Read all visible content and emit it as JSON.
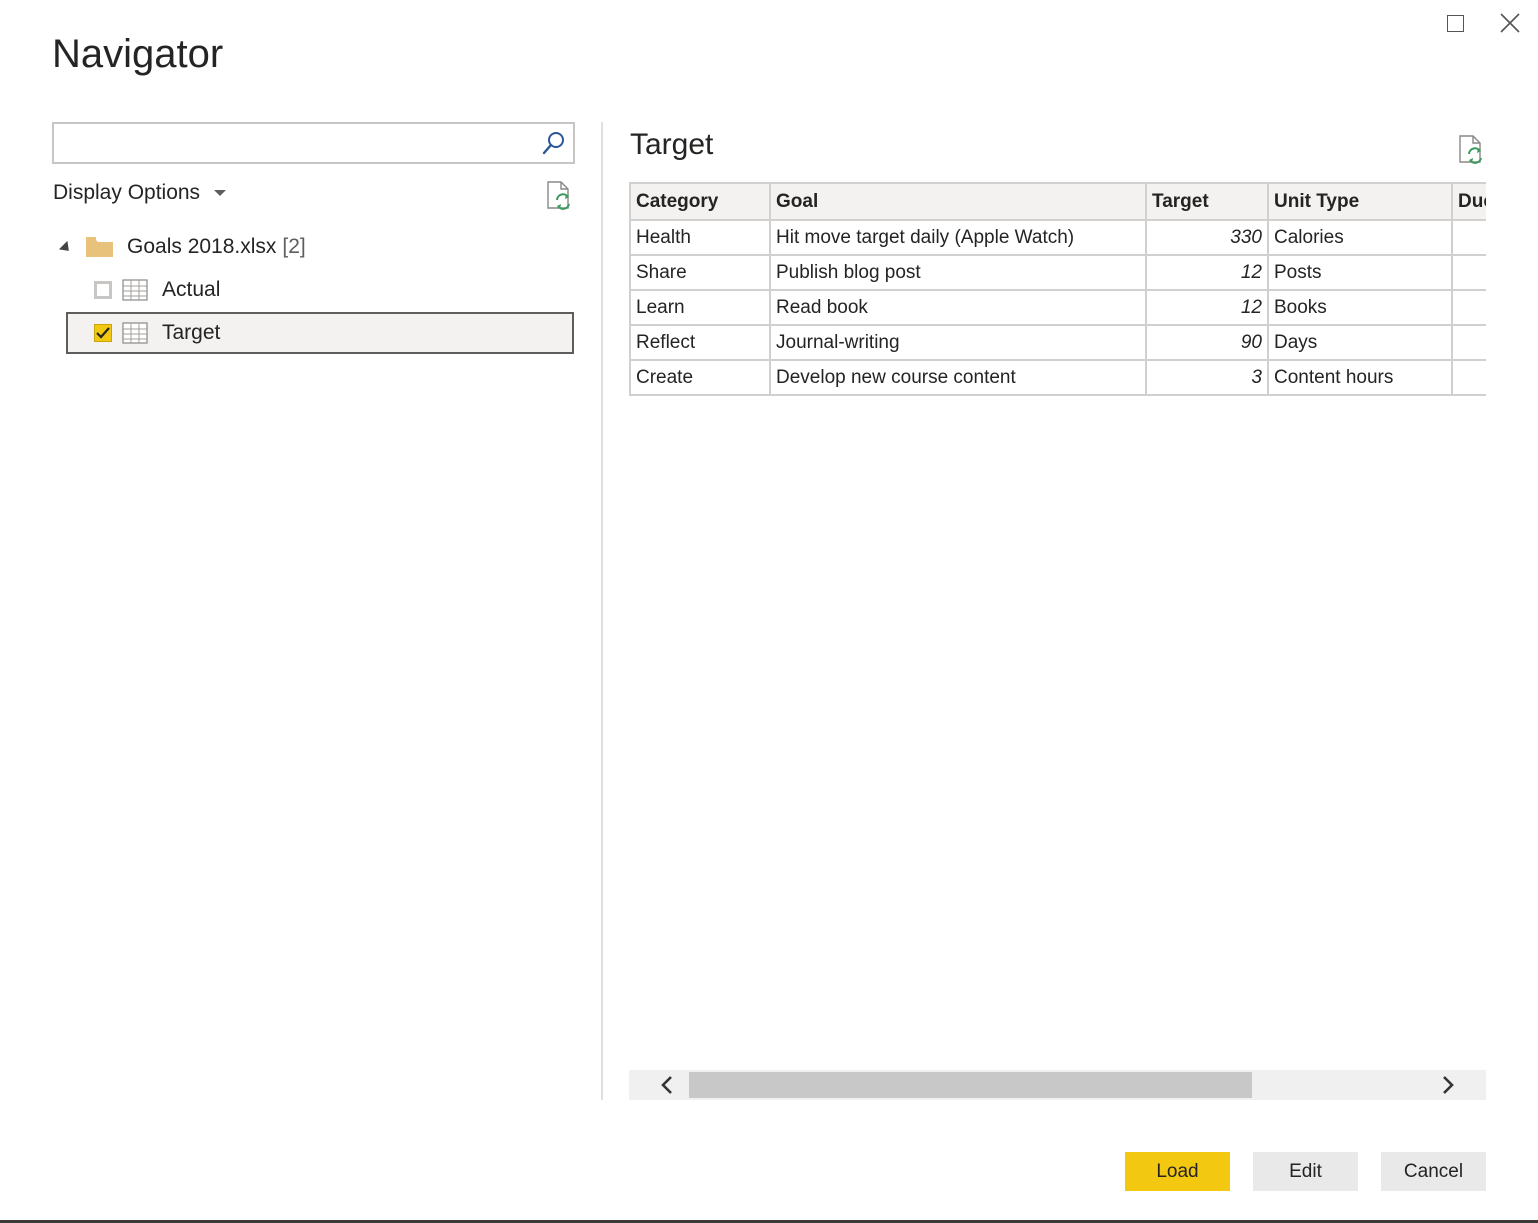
{
  "window": {
    "title": "Navigator"
  },
  "search": {
    "value": "",
    "placeholder": ""
  },
  "display_options": {
    "label": "Display Options"
  },
  "tree": {
    "root": {
      "name": "Goals 2018.xlsx",
      "count": "[2]"
    },
    "items": [
      {
        "label": "Actual",
        "checked": false,
        "selected": false
      },
      {
        "label": "Target",
        "checked": true,
        "selected": true
      }
    ]
  },
  "preview": {
    "title": "Target",
    "columns": [
      "Category",
      "Goal",
      "Target",
      "Unit Type",
      "Due"
    ],
    "rows": [
      [
        "Health",
        "Hit move target daily (Apple Watch)",
        "330",
        "Calories",
        ""
      ],
      [
        "Share",
        "Publish blog post",
        "12",
        "Posts",
        ""
      ],
      [
        "Learn",
        "Read book",
        "12",
        "Books",
        ""
      ],
      [
        "Reflect",
        "Journal-writing",
        "90",
        "Days",
        ""
      ],
      [
        "Create",
        "Develop new course content",
        "3",
        "Content hours",
        ""
      ]
    ]
  },
  "buttons": {
    "load": "Load",
    "edit": "Edit",
    "cancel": "Cancel"
  },
  "colors": {
    "accent": "#F2C811",
    "folder": "#E8C27A",
    "refresh": "#3C9A5F"
  }
}
